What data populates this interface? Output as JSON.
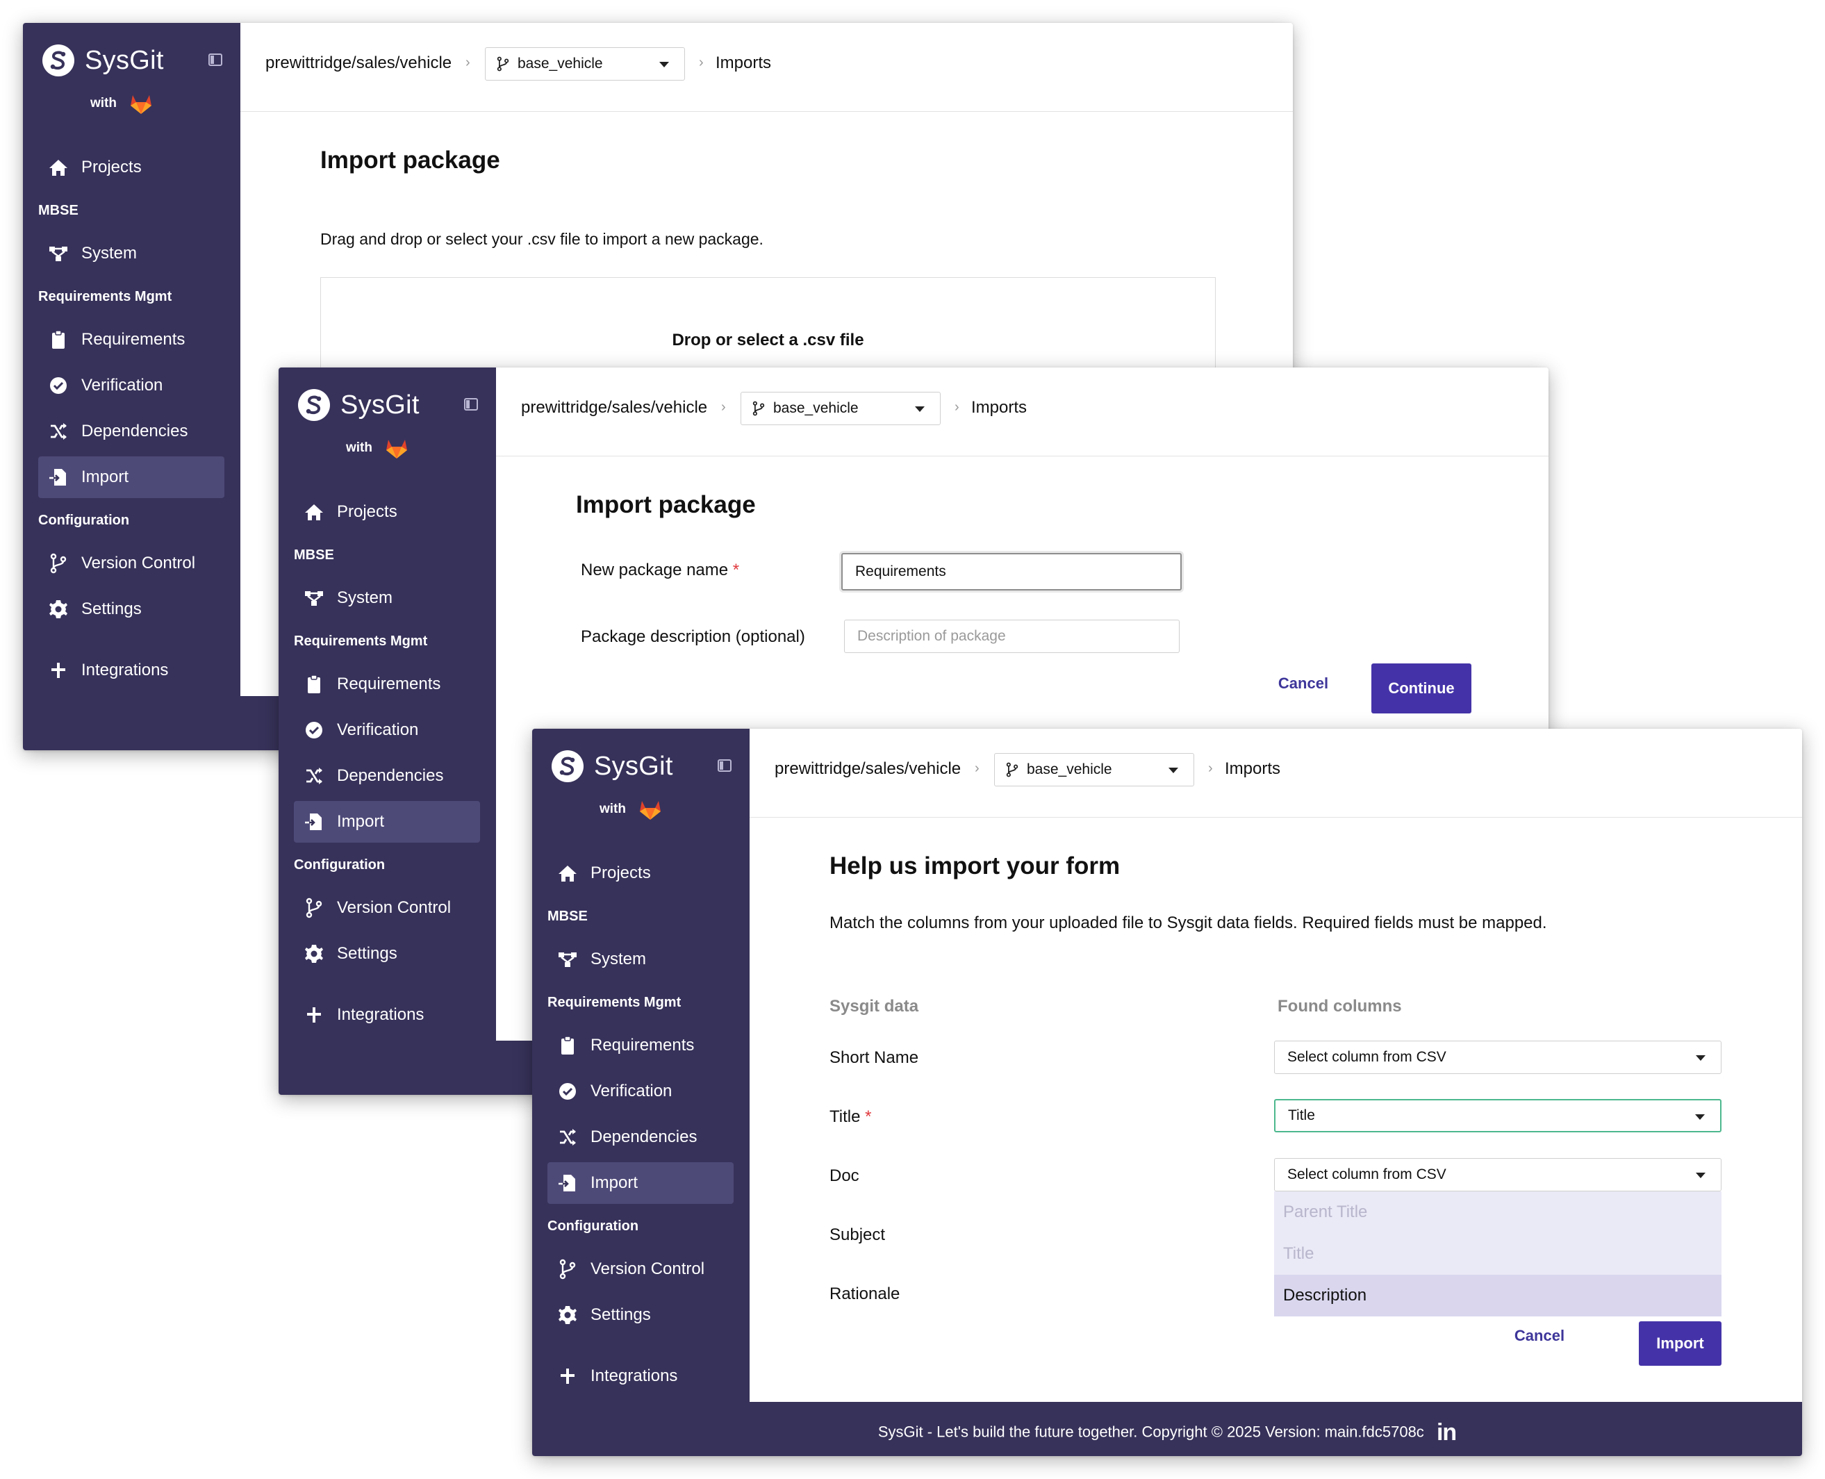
{
  "brand": {
    "name": "SysGit",
    "with_label": "with"
  },
  "nav": {
    "projects": "Projects",
    "section_mbse": "MBSE",
    "system": "System",
    "section_req": "Requirements Mgmt",
    "requirements": "Requirements",
    "verification": "Verification",
    "dependencies": "Dependencies",
    "import": "Import",
    "section_config": "Configuration",
    "version_control": "Version Control",
    "settings": "Settings",
    "integrations": "Integrations"
  },
  "breadcrumb": {
    "path": "prewittridge/sales/vehicle",
    "branch": "base_vehicle",
    "current": "Imports",
    "separator": "›"
  },
  "screen1": {
    "title": "Import package",
    "instructions": "Drag and drop or select your .csv file to import a new package.",
    "dropzone_label": "Drop or select a .csv file"
  },
  "screen2": {
    "title": "Import package",
    "name_label": "New package name",
    "required_mark": "*",
    "name_value": "Requirements",
    "desc_label": "Package description (optional)",
    "desc_placeholder": "Description of package",
    "cancel": "Cancel",
    "continue": "Continue"
  },
  "screen3": {
    "title": "Help us import your form",
    "instructions": "Match the columns from your uploaded file to Sysgit data fields. Required fields must be mapped.",
    "col_sysgit": "Sysgit data",
    "col_found": "Found columns",
    "required_mark": "*",
    "fields": {
      "short_name": "Short Name",
      "title": "Title",
      "doc": "Doc",
      "subject": "Subject",
      "rationale": "Rationale"
    },
    "select_short_name": "Select column from CSV",
    "select_title": "Title",
    "select_doc": "Select column from CSV",
    "options": [
      "Parent Title",
      "Title",
      "Description"
    ],
    "cancel": "Cancel",
    "import": "Import"
  },
  "footer": {
    "text": "SysGit - Let's build the future together.  Copyright © 2025  Version: main.fdc5708c",
    "linkedin": "in"
  },
  "colors": {
    "sidebar": "#37325a",
    "active_item": "#4e4a78",
    "primary": "#4433a8",
    "valid": "#4db88e",
    "required": "#e0393e"
  }
}
